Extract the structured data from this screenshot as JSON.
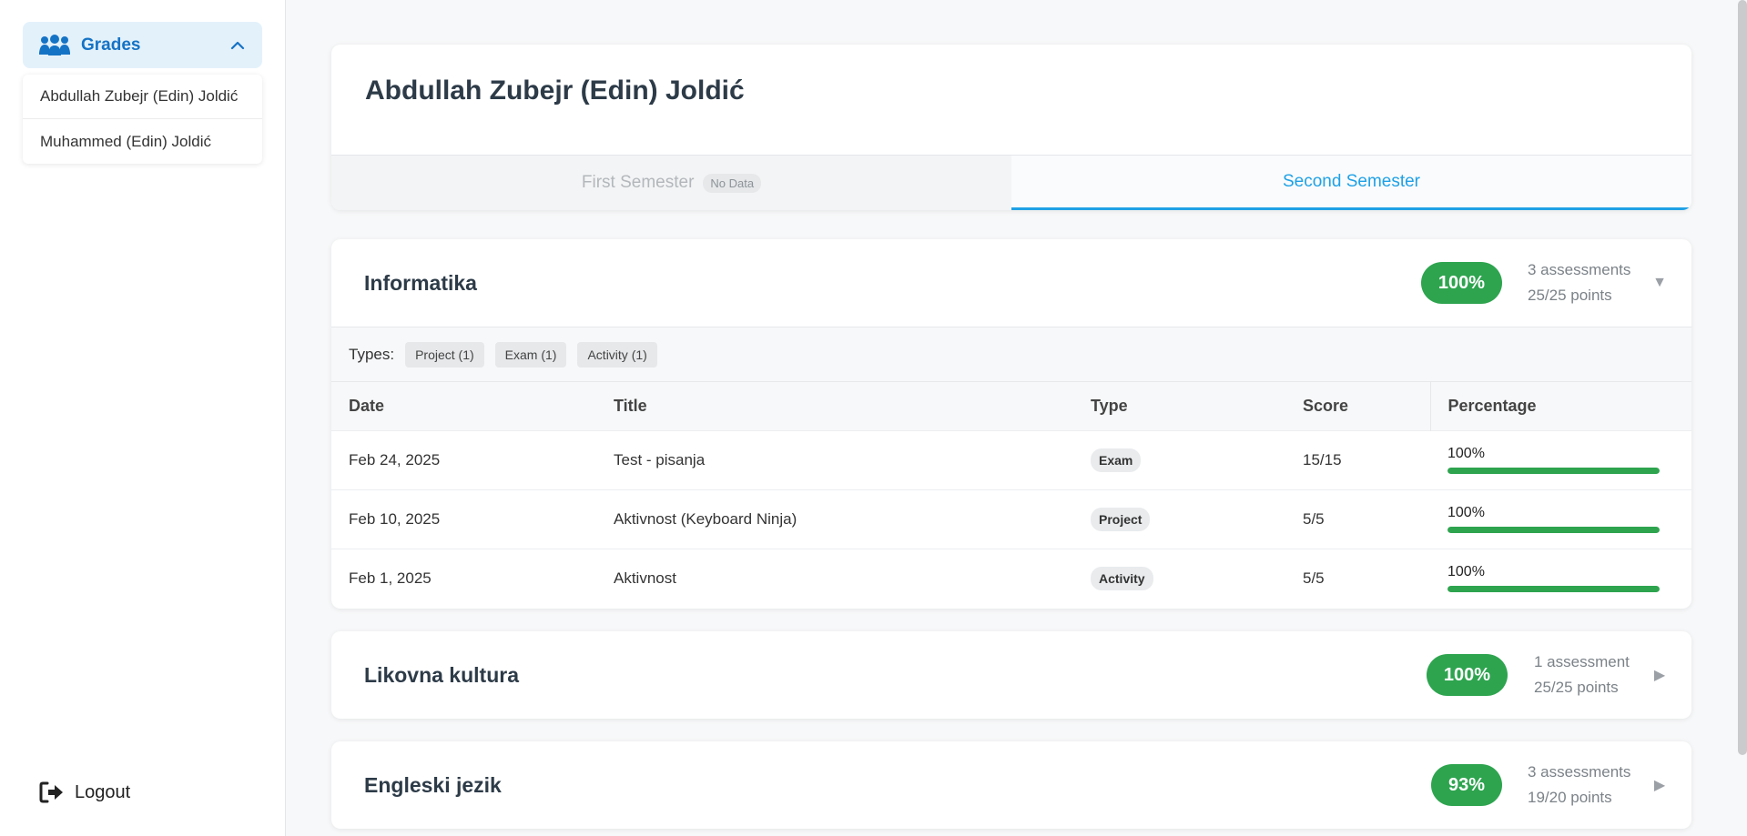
{
  "sidebar": {
    "section_title": "Grades",
    "students": [
      "Abdullah Zubejr (Edin) Joldić",
      "Muhammed (Edin) Joldić"
    ],
    "logout_label": "Logout"
  },
  "header": {
    "student_name": "Abdullah Zubejr (Edin) Joldić",
    "tabs": [
      {
        "label": "First Semester",
        "badge": "No Data"
      },
      {
        "label": "Second Semester"
      }
    ]
  },
  "subjects": [
    {
      "name": "Informatika",
      "percent": "100%",
      "assessments": "3 assessments",
      "points": "25/25 points",
      "expanded": true,
      "types_label": "Types:",
      "types": [
        "Project (1)",
        "Exam (1)",
        "Activity (1)"
      ],
      "columns": [
        "Date",
        "Title",
        "Type",
        "Score",
        "Percentage"
      ],
      "rows": [
        {
          "date": "Feb 24, 2025",
          "title": "Test - pisanja",
          "type": "Exam",
          "score": "15/15",
          "percentage": "100%",
          "fill": 1.0
        },
        {
          "date": "Feb 10, 2025",
          "title": "Aktivnost (Keyboard Ninja)",
          "type": "Project",
          "score": "5/5",
          "percentage": "100%",
          "fill": 1.0
        },
        {
          "date": "Feb 1, 2025",
          "title": "Aktivnost",
          "type": "Activity",
          "score": "5/5",
          "percentage": "100%",
          "fill": 1.0
        }
      ]
    },
    {
      "name": "Likovna kultura",
      "percent": "100%",
      "assessments": "1 assessment",
      "points": "25/25 points",
      "expanded": false
    },
    {
      "name": "Engleski jezik",
      "percent": "93%",
      "assessments": "3 assessments",
      "points": "19/20 points",
      "expanded": false
    }
  ],
  "colors": {
    "accent_blue": "#1573c5",
    "tab_active": "#1fa1e6",
    "success_green": "#2ea44f"
  },
  "icons": {
    "grades": "users-group-icon",
    "collapse": "chevron-up-icon",
    "logout": "sign-out-icon",
    "expanded": "caret-down-icon",
    "collapsed": "caret-right-icon"
  }
}
